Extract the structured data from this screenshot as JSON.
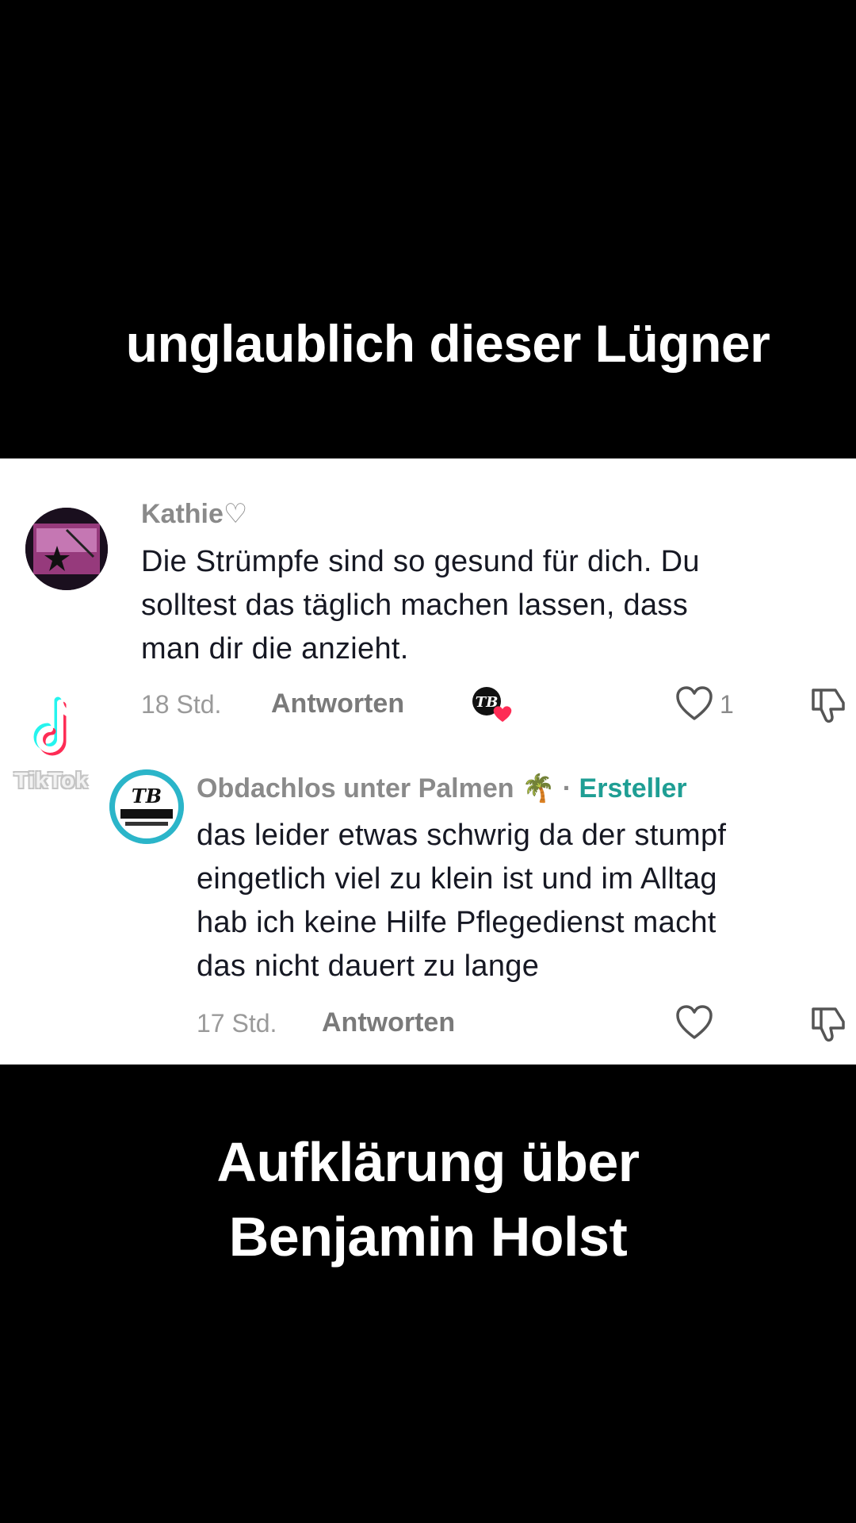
{
  "overlay": {
    "top_caption": "unglaublich dieser Lügner",
    "bottom_caption_line1": "Aufklärung über",
    "bottom_caption_line2": "Benjamin Holst"
  },
  "watermark": {
    "text": "TikTok"
  },
  "comments": [
    {
      "username": "Kathie♡",
      "text_lines": [
        "Die Strümpfe sind so gesund für dich. Du",
        "solltest das täglich machen lassen, dass",
        "man dir die anzieht."
      ],
      "time": "18 Std.",
      "reply_label": "Antworten",
      "like_count": "1",
      "liked_by_creator_badge": "TB"
    },
    {
      "username": "Obdachlos unter Palmen 🌴",
      "separator": "·",
      "creator_tag": "Ersteller",
      "text_lines": [
        "das leider etwas schwrig da der stumpf",
        "eingetlich viel zu klein ist und im Alltag",
        "hab ich keine Hilfe Pflegedienst macht",
        "das nicht dauert zu lange"
      ],
      "time": "17 Std.",
      "reply_label": "Antworten",
      "avatar_text": "TB"
    }
  ],
  "icons": {
    "like": "heart-outline-icon",
    "dislike": "thumbs-down-icon",
    "watermark": "tiktok-logo-icon"
  },
  "colors": {
    "creator_tag": "#1f9e94",
    "heart_badge": "#fe2c55"
  }
}
